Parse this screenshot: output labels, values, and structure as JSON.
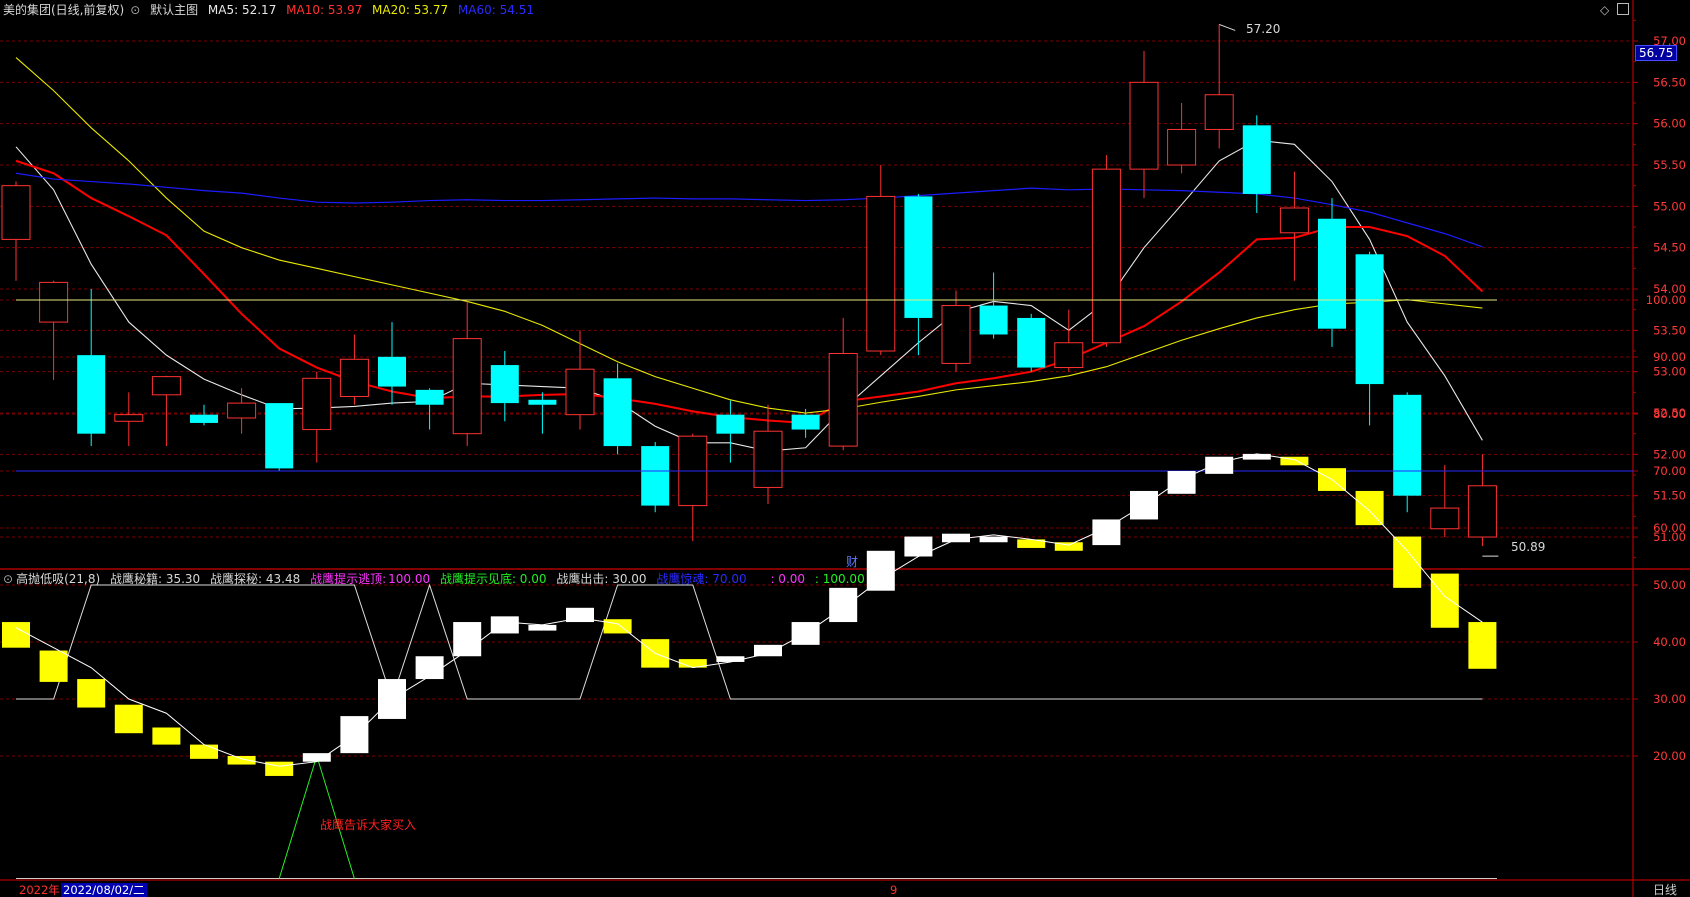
{
  "header": {
    "stock_label": "美的集团(日线,前复权)",
    "main_chart_label": "默认主图",
    "ma5": "MA5: 52.17",
    "ma10": "MA10: 53.97",
    "ma20": "MA20: 53.77",
    "ma60": "MA60: 54.51"
  },
  "indicator_header": {
    "name": "高抛低吸(21,8)",
    "v1": "战鹰秘籍: 35.30",
    "v2": "战鹰探秘: 43.48",
    "v3_label": "战鹰提示逃顶:",
    "v3_value": "100.00",
    "v4": "战鹰提示见底: 0.00",
    "v5": "战鹰出击: 30.00",
    "v6": "战鹰惊魂: 70.00",
    "v7": ": 0.00",
    "v8": ": 100.00"
  },
  "price_tag": "56.75",
  "high_label": "57.20",
  "low_label": "50.89",
  "event_marker": "财",
  "buy_signal_text": "战鹰告诉大家买入",
  "footer": {
    "year_label": "2022年",
    "date_label": "2022/08/02/二",
    "month_label": "9",
    "period_label": "日线"
  },
  "colors": {
    "up": "#ff3232",
    "down": "#00ffff",
    "ma5": "#e8e8e8",
    "ma10": "#ff0000",
    "ma20": "#e8e800",
    "ma60": "#1c1cff",
    "grid": "#7a0000"
  },
  "chart_data": [
    {
      "type": "candlestick",
      "title": "美的集团(日线,前复权)",
      "y_ticks": [
        "57.00",
        "56.50",
        "56.00",
        "55.50",
        "55.00",
        "54.50",
        "54.00",
        "53.50",
        "53.00",
        "52.50",
        "52.00",
        "51.50",
        "51.00"
      ],
      "ylim": [
        50.6,
        57.45
      ],
      "candles": [
        {
          "o": 54.6,
          "h": 55.3,
          "l": 54.1,
          "c": 55.25
        },
        {
          "o": 53.6,
          "h": 54.1,
          "l": 52.9,
          "c": 54.08
        },
        {
          "o": 53.2,
          "h": 54.0,
          "l": 52.1,
          "c": 52.25
        },
        {
          "o": 52.4,
          "h": 52.75,
          "l": 52.1,
          "c": 52.48
        },
        {
          "o": 52.72,
          "h": 52.95,
          "l": 52.1,
          "c": 52.94
        },
        {
          "o": 52.48,
          "h": 52.6,
          "l": 52.35,
          "c": 52.38
        },
        {
          "o": 52.44,
          "h": 52.8,
          "l": 52.25,
          "c": 52.62
        },
        {
          "o": 52.62,
          "h": 52.62,
          "l": 51.8,
          "c": 51.83
        },
        {
          "o": 52.3,
          "h": 53.0,
          "l": 51.9,
          "c": 52.92
        },
        {
          "o": 52.7,
          "h": 53.45,
          "l": 52.6,
          "c": 53.15
        },
        {
          "o": 53.18,
          "h": 53.6,
          "l": 52.6,
          "c": 52.82
        },
        {
          "o": 52.78,
          "h": 52.8,
          "l": 52.3,
          "c": 52.6
        },
        {
          "o": 52.25,
          "h": 53.85,
          "l": 52.1,
          "c": 53.4
        },
        {
          "o": 53.08,
          "h": 53.25,
          "l": 52.4,
          "c": 52.62
        },
        {
          "o": 52.66,
          "h": 52.75,
          "l": 52.25,
          "c": 52.6
        },
        {
          "o": 52.48,
          "h": 53.5,
          "l": 52.3,
          "c": 53.03
        },
        {
          "o": 52.92,
          "h": 53.1,
          "l": 52.0,
          "c": 52.1
        },
        {
          "o": 52.1,
          "h": 52.15,
          "l": 51.3,
          "c": 51.38
        },
        {
          "o": 51.38,
          "h": 52.25,
          "l": 50.95,
          "c": 52.22
        },
        {
          "o": 52.48,
          "h": 52.65,
          "l": 51.9,
          "c": 52.25
        },
        {
          "o": 51.6,
          "h": 52.6,
          "l": 51.4,
          "c": 52.28
        },
        {
          "o": 52.48,
          "h": 52.55,
          "l": 52.2,
          "c": 52.3
        },
        {
          "o": 52.1,
          "h": 53.65,
          "l": 52.05,
          "c": 53.22
        },
        {
          "o": 53.25,
          "h": 55.5,
          "l": 53.2,
          "c": 55.12
        },
        {
          "o": 55.12,
          "h": 55.15,
          "l": 53.2,
          "c": 53.65
        },
        {
          "o": 53.1,
          "h": 53.98,
          "l": 53.0,
          "c": 53.8
        },
        {
          "o": 53.8,
          "h": 54.2,
          "l": 53.4,
          "c": 53.45
        },
        {
          "o": 53.65,
          "h": 53.7,
          "l": 53.0,
          "c": 53.05
        },
        {
          "o": 53.05,
          "h": 53.75,
          "l": 53.0,
          "c": 53.35
        },
        {
          "o": 53.35,
          "h": 55.62,
          "l": 53.3,
          "c": 55.45
        },
        {
          "o": 55.45,
          "h": 56.88,
          "l": 55.1,
          "c": 56.5
        },
        {
          "o": 55.5,
          "h": 56.25,
          "l": 55.4,
          "c": 55.93
        },
        {
          "o": 55.93,
          "h": 57.2,
          "l": 55.7,
          "c": 56.35
        },
        {
          "o": 55.98,
          "h": 56.1,
          "l": 54.92,
          "c": 55.15
        },
        {
          "o": 54.68,
          "h": 55.42,
          "l": 54.1,
          "c": 54.98
        },
        {
          "o": 54.85,
          "h": 55.1,
          "l": 53.3,
          "c": 53.52
        },
        {
          "o": 54.42,
          "h": 54.45,
          "l": 52.35,
          "c": 52.85
        },
        {
          "o": 52.72,
          "h": 52.75,
          "l": 51.3,
          "c": 51.5
        },
        {
          "o": 51.1,
          "h": 51.87,
          "l": 51.0,
          "c": 51.35
        },
        {
          "o": 51.0,
          "h": 52.0,
          "l": 50.89,
          "c": 51.62
        }
      ],
      "series": [
        {
          "name": "MA5",
          "values": [
            55.72,
            55.2,
            54.3,
            53.6,
            53.2,
            52.91,
            52.72,
            52.55,
            52.56,
            52.58,
            52.62,
            52.64,
            52.86,
            52.84,
            52.82,
            52.8,
            52.64,
            52.34,
            52.14,
            52.14,
            52.04,
            52.08,
            52.55,
            52.95,
            53.35,
            53.72,
            53.85,
            53.8,
            53.5,
            53.85,
            54.5,
            55.02,
            55.55,
            55.8,
            55.75,
            55.3,
            54.6,
            53.6,
            52.95,
            52.17
          ]
        },
        {
          "name": "MA10",
          "values": [
            55.55,
            55.4,
            55.1,
            54.88,
            54.65,
            54.18,
            53.7,
            53.28,
            53.05,
            52.88,
            52.76,
            52.68,
            52.7,
            52.7,
            52.72,
            52.73,
            52.68,
            52.61,
            52.52,
            52.45,
            52.41,
            52.38,
            52.64,
            52.7,
            52.76,
            52.86,
            52.92,
            53.0,
            53.15,
            53.35,
            53.55,
            53.85,
            54.2,
            54.6,
            54.62,
            54.75,
            54.75,
            54.64,
            54.4,
            53.97
          ]
        },
        {
          "name": "MA20",
          "values": [
            56.8,
            56.4,
            55.95,
            55.55,
            55.1,
            54.7,
            54.5,
            54.35,
            54.25,
            54.15,
            54.05,
            53.95,
            53.85,
            53.73,
            53.56,
            53.34,
            53.12,
            52.94,
            52.8,
            52.66,
            52.56,
            52.5,
            52.55,
            52.63,
            52.7,
            52.78,
            52.83,
            52.88,
            52.95,
            53.06,
            53.22,
            53.38,
            53.52,
            53.65,
            53.75,
            53.82,
            53.84,
            53.87,
            53.82,
            53.77
          ]
        },
        {
          "name": "MA60",
          "values": [
            55.4,
            55.33,
            55.3,
            55.27,
            55.23,
            55.19,
            55.16,
            55.1,
            55.05,
            55.04,
            55.05,
            55.07,
            55.08,
            55.07,
            55.07,
            55.08,
            55.09,
            55.1,
            55.09,
            55.09,
            55.08,
            55.07,
            55.08,
            55.1,
            55.13,
            55.16,
            55.19,
            55.22,
            55.2,
            55.21,
            55.2,
            55.19,
            55.17,
            55.15,
            55.1,
            55.02,
            54.93,
            54.8,
            54.67,
            54.51
          ]
        }
      ]
    },
    {
      "type": "bar",
      "title": "高抛低吸(21,8)",
      "y_ticks": [
        "100.00",
        "90.00",
        "80.00",
        "70.00",
        "60.00",
        "50.00",
        "40.00",
        "30.00",
        "20.00"
      ],
      "ylim": [
        0,
        104
      ],
      "bars": [
        {
          "top": 43.5,
          "bot": 39.0,
          "color": "yellow"
        },
        {
          "top": 38.5,
          "bot": 33.0,
          "color": "yellow"
        },
        {
          "top": 33.5,
          "bot": 28.5,
          "color": "yellow"
        },
        {
          "top": 29.0,
          "bot": 24.0,
          "color": "yellow"
        },
        {
          "top": 25.0,
          "bot": 22.0,
          "color": "yellow"
        },
        {
          "top": 22.0,
          "bot": 19.5,
          "color": "yellow"
        },
        {
          "top": 20.0,
          "bot": 18.5,
          "color": "yellow"
        },
        {
          "top": 19.0,
          "bot": 16.5,
          "color": "yellow"
        },
        {
          "top": 20.5,
          "bot": 19.0,
          "color": "white"
        },
        {
          "top": 27.0,
          "bot": 20.5,
          "color": "white"
        },
        {
          "top": 33.5,
          "bot": 26.5,
          "color": "white"
        },
        {
          "top": 37.5,
          "bot": 33.5,
          "color": "white"
        },
        {
          "top": 43.5,
          "bot": 37.5,
          "color": "white"
        },
        {
          "top": 44.5,
          "bot": 41.5,
          "color": "white"
        },
        {
          "top": 43.0,
          "bot": 42.0,
          "color": "white"
        },
        {
          "top": 46.0,
          "bot": 43.5,
          "color": "white"
        },
        {
          "top": 44.0,
          "bot": 41.5,
          "color": "yellow"
        },
        {
          "top": 40.5,
          "bot": 35.5,
          "color": "yellow"
        },
        {
          "top": 37.0,
          "bot": 35.5,
          "color": "yellow"
        },
        {
          "top": 37.5,
          "bot": 36.5,
          "color": "white"
        },
        {
          "top": 39.5,
          "bot": 37.5,
          "color": "white"
        },
        {
          "top": 43.5,
          "bot": 39.5,
          "color": "white"
        },
        {
          "top": 49.5,
          "bot": 43.5,
          "color": "white"
        },
        {
          "top": 56.0,
          "bot": 49.0,
          "color": "white"
        },
        {
          "top": 58.5,
          "bot": 55.0,
          "color": "white"
        },
        {
          "top": 59.0,
          "bot": 57.5,
          "color": "white"
        },
        {
          "top": 58.5,
          "bot": 57.5,
          "color": "white"
        },
        {
          "top": 58.0,
          "bot": 56.5,
          "color": "yellow"
        },
        {
          "top": 57.5,
          "bot": 56.0,
          "color": "yellow"
        },
        {
          "top": 61.5,
          "bot": 57.0,
          "color": "white"
        },
        {
          "top": 66.5,
          "bot": 61.5,
          "color": "white"
        },
        {
          "top": 70.0,
          "bot": 66.0,
          "color": "white"
        },
        {
          "top": 72.5,
          "bot": 69.5,
          "color": "white"
        },
        {
          "top": 73.0,
          "bot": 72.0,
          "color": "white"
        },
        {
          "top": 72.5,
          "bot": 71.0,
          "color": "yellow"
        },
        {
          "top": 70.5,
          "bot": 66.5,
          "color": "yellow"
        },
        {
          "top": 66.5,
          "bot": 60.5,
          "color": "yellow"
        },
        {
          "top": 58.5,
          "bot": 49.5,
          "color": "yellow"
        },
        {
          "top": 52.0,
          "bot": 42.5,
          "color": "yellow"
        },
        {
          "top": 43.5,
          "bot": 35.3,
          "color": "yellow"
        }
      ],
      "thin_line": [
        42.5,
        39.0,
        35.5,
        30.0,
        27.5,
        22.0,
        19.5,
        18.2,
        19.0,
        23.5,
        30.0,
        34.0,
        38.5,
        43.5,
        43.0,
        44.2,
        43.2,
        38.0,
        35.5,
        36.5,
        38.0,
        41.5,
        46.0,
        51.0,
        55.0,
        58.0,
        58.8,
        58.0,
        57.0,
        60.0,
        64.0,
        68.5,
        71.5,
        73.0,
        72.0,
        68.5,
        63.0,
        56.0,
        48.0,
        43.48
      ],
      "band_line": [
        30,
        30,
        50,
        50,
        50,
        50,
        50,
        50,
        50,
        50,
        30,
        50,
        30,
        30,
        30,
        30,
        50,
        50,
        50,
        30,
        30,
        30,
        30,
        30,
        30,
        30,
        30,
        30,
        30,
        30,
        30,
        30,
        30,
        30,
        30,
        30,
        30,
        30,
        30,
        30
      ],
      "reference_lines": [
        100,
        70,
        0
      ]
    }
  ]
}
